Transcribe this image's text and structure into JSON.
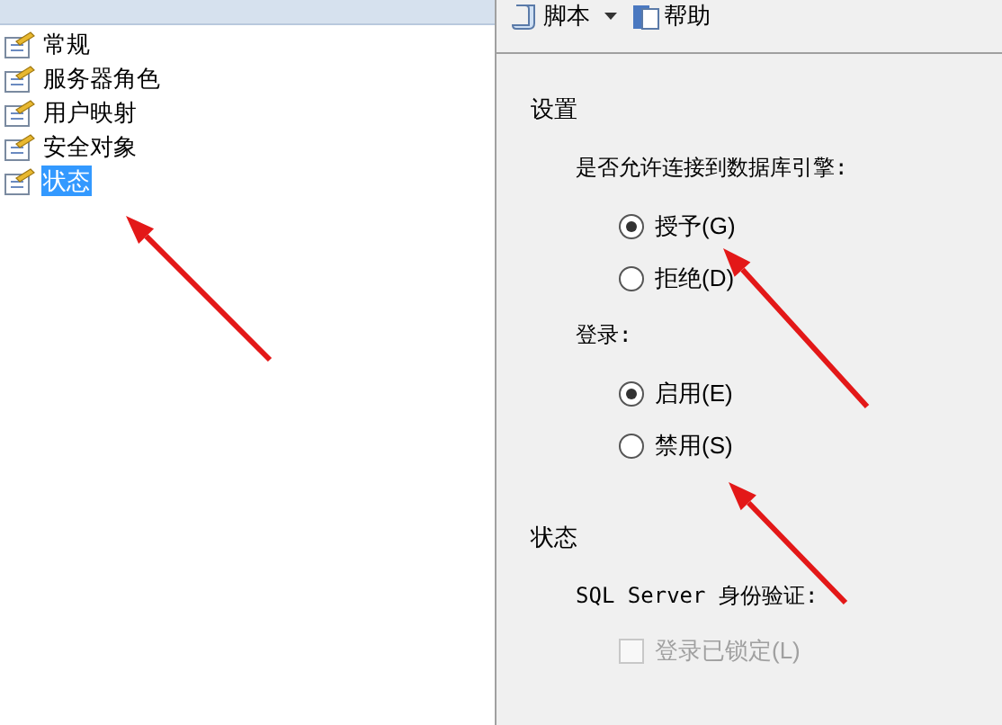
{
  "sidebar": {
    "items": [
      {
        "label": "常规",
        "selected": false
      },
      {
        "label": "服务器角色",
        "selected": false
      },
      {
        "label": "用户映射",
        "selected": false
      },
      {
        "label": "安全对象",
        "selected": false
      },
      {
        "label": "状态",
        "selected": true
      }
    ]
  },
  "toolbar": {
    "buttons": [
      {
        "label": "脚本",
        "kind": "script"
      },
      {
        "label": "帮助",
        "kind": "help"
      }
    ]
  },
  "sections": [
    {
      "title": "设置",
      "groups": [
        {
          "label": "是否允许连接到数据库引擎:",
          "options": [
            {
              "label": "授予(G)",
              "selected": true
            },
            {
              "label": "拒绝(D)",
              "selected": false
            }
          ]
        },
        {
          "label": "登录:",
          "options": [
            {
              "label": "启用(E)",
              "selected": true
            },
            {
              "label": "禁用(S)",
              "selected": false
            }
          ]
        }
      ]
    },
    {
      "title": "状态",
      "groups": [
        {
          "label": "SQL Server 身份验证:",
          "checkboxes": [
            {
              "label": "登录已锁定(L)",
              "checked": false,
              "disabled": true
            }
          ]
        }
      ]
    }
  ]
}
